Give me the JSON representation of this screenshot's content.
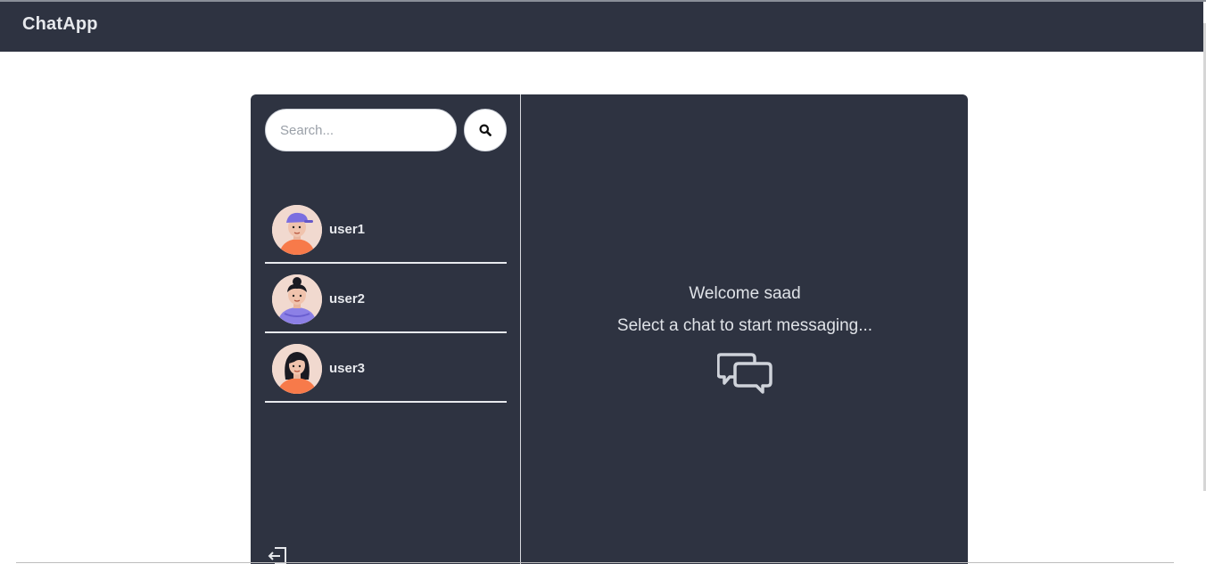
{
  "app": {
    "title": "ChatApp"
  },
  "search": {
    "placeholder": "Search...",
    "value": ""
  },
  "sidebar": {
    "users": [
      {
        "name": "user1",
        "avatar": "cap-avatar-icon"
      },
      {
        "name": "user2",
        "avatar": "bun-hair-avatar-icon"
      },
      {
        "name": "user3",
        "avatar": "long-hair-avatar-icon"
      }
    ],
    "logout_icon": "logout-icon"
  },
  "main": {
    "welcome": "Welcome saad",
    "prompt": "Select a chat to start messaging...",
    "icon": "chat-bubbles-icon"
  },
  "colors": {
    "navbar": "#2e3341",
    "panel": "#2e3341",
    "text": "#e6e8ec",
    "avatar_orange": "#f77a4a",
    "avatar_purple": "#7b6ee0"
  }
}
